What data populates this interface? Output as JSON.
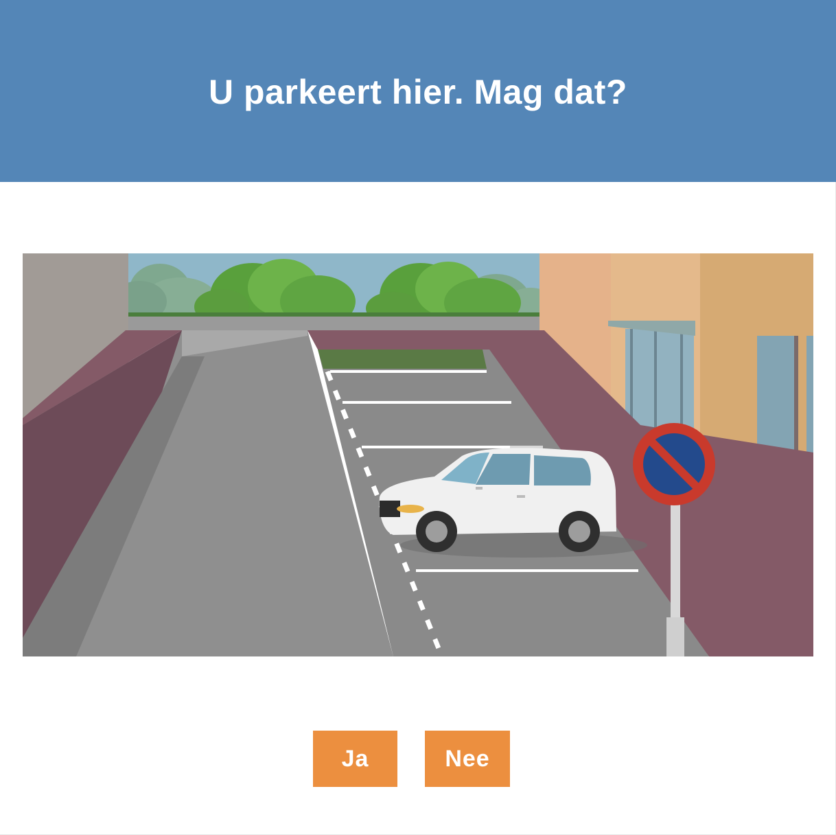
{
  "question": {
    "title": "U parkeert hier. Mag dat?"
  },
  "illustration": {
    "scene": "parking-lot-street",
    "sign_icon": "no-parking-sign-icon",
    "colors": {
      "header": "#5486b7",
      "button": "#ec8f3f",
      "road": "#8f8f8f",
      "sidewalk": "#845a67",
      "sign_red": "#c93a2c",
      "sign_blue": "#234a8c"
    }
  },
  "answers": [
    {
      "label": "Ja"
    },
    {
      "label": "Nee"
    }
  ]
}
